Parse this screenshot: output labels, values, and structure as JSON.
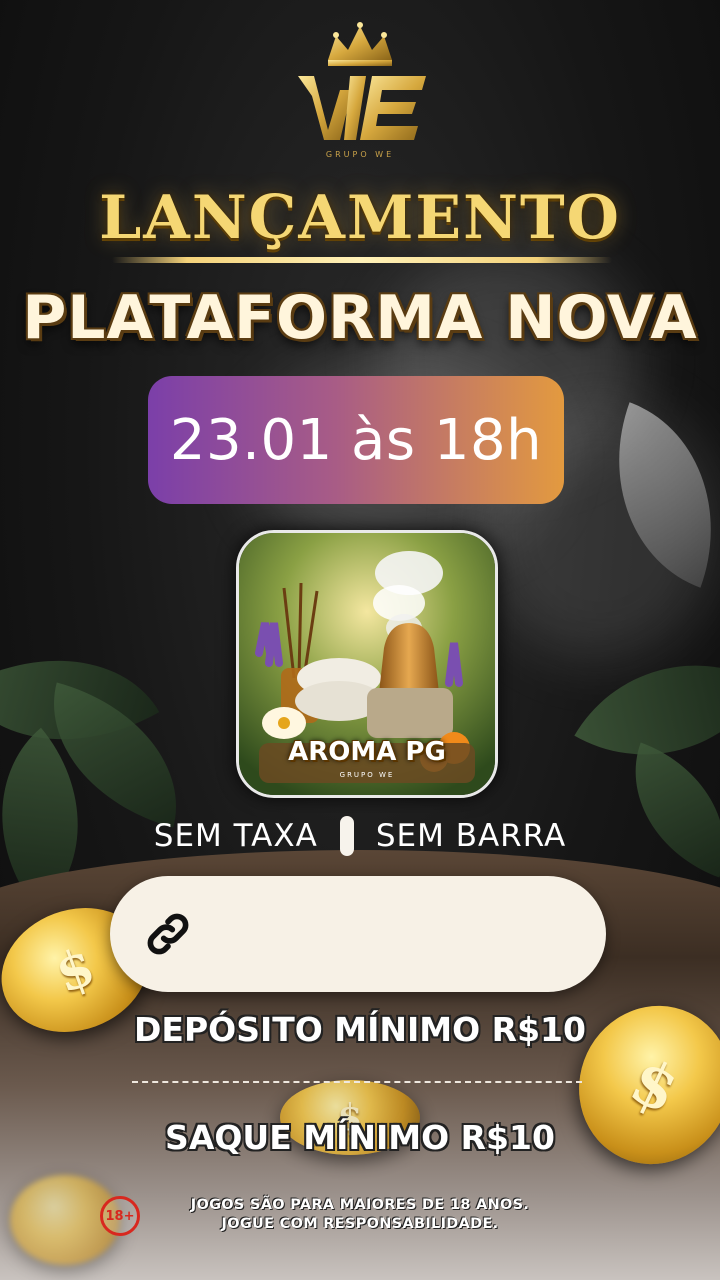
{
  "brand": {
    "sub": "GRUPO WE",
    "logo_icon": "crown-we-logo-icon"
  },
  "headline": {
    "line1": "LANÇAMENTO",
    "line2": "PLATAFORMA NOVA"
  },
  "launch": {
    "date": "23.01 às 18h"
  },
  "app": {
    "name": "AROMA PG",
    "sub": "GRUPO WE"
  },
  "features": {
    "left": "SEM TAXA",
    "right": "SEM BARRA"
  },
  "link": {
    "icon": "link-icon",
    "url": ""
  },
  "info": {
    "deposit": "DEPÓSITO MÍNIMO R$10",
    "withdraw": "SAQUE MÍNIMO R$10"
  },
  "disclaimer": {
    "badge": "18+",
    "line1": "JOGOS SÃO PARA MAIORES DE 18 ANOS.",
    "line2": "JOGUE COM RESPONSABILIDADE."
  },
  "coin_symbol": "$",
  "colors": {
    "gold": "#f5d774",
    "purple": "#7b3fa9",
    "orange": "#e39a3f",
    "cream": "#f7f1e6"
  }
}
